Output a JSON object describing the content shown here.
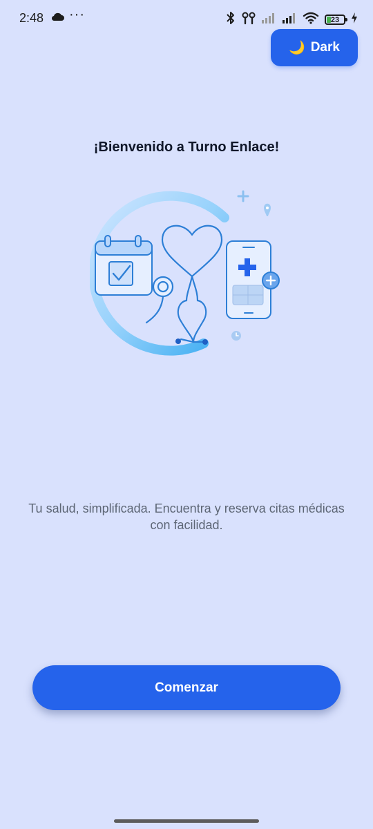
{
  "status_bar": {
    "time": "2:48",
    "more_dots": "···",
    "battery_level": "23",
    "icons": [
      "cloud-icon",
      "bluetooth-icon",
      "earbuds-icon",
      "signal-icon",
      "signal-icon",
      "wifi-icon",
      "battery-icon",
      "charging-icon"
    ]
  },
  "theme_toggle": {
    "icon": "🌙",
    "label": "Dark"
  },
  "welcome": {
    "title": "¡Bienvenido a Turno Enlace!",
    "subtitle": "Tu salud, simplificada. Encuentra y reserva citas médicas con facilidad."
  },
  "illustration": {
    "icons": [
      "calendar-check-icon",
      "heart-stethoscope-icon",
      "phone-medical-icon",
      "location-pin-icon",
      "clock-icon",
      "plus-icon"
    ]
  },
  "actions": {
    "start_label": "Comenzar"
  },
  "colors": {
    "background": "#d9e1fd",
    "primary": "#2563eb",
    "title": "#10172a",
    "subtitle": "#5d6675",
    "illustration_stroke": "#2d7fd6"
  }
}
